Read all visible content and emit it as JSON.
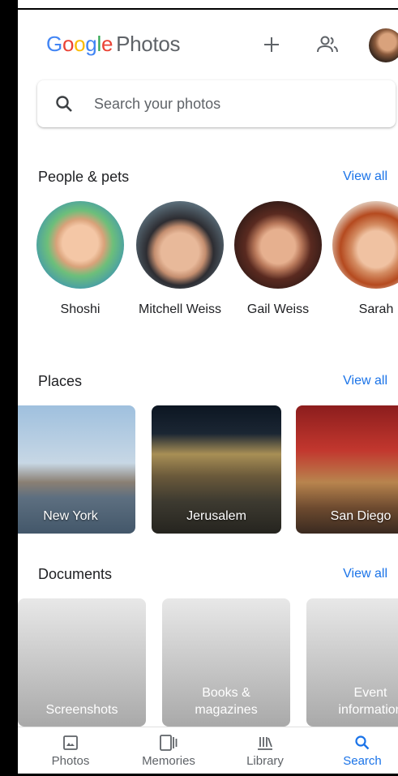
{
  "header": {
    "logo_google": "Google",
    "logo_photos": "Photos"
  },
  "search": {
    "placeholder": "Search your photos"
  },
  "people": {
    "title": "People & pets",
    "view_all": "View all",
    "items": [
      {
        "name": "Shoshi"
      },
      {
        "name": "Mitchell Weiss"
      },
      {
        "name": "Gail Weiss"
      },
      {
        "name": "Sarah"
      }
    ]
  },
  "places": {
    "title": "Places",
    "view_all": "View all",
    "items": [
      {
        "name": "New York"
      },
      {
        "name": "Jerusalem"
      },
      {
        "name": "San Diego"
      }
    ]
  },
  "documents": {
    "title": "Documents",
    "view_all": "View all",
    "items": [
      {
        "name": "Screenshots"
      },
      {
        "name": "Books & magazines"
      },
      {
        "name": "Event information"
      }
    ]
  },
  "nav": {
    "items": [
      {
        "label": "Photos",
        "icon": "photo-icon"
      },
      {
        "label": "Memories",
        "icon": "memories-icon"
      },
      {
        "label": "Library",
        "icon": "library-icon"
      },
      {
        "label": "Search",
        "icon": "search-icon"
      }
    ],
    "active": "Search"
  },
  "colors": {
    "accent": "#1a73e8",
    "text": "#202124",
    "muted": "#5f6368"
  }
}
